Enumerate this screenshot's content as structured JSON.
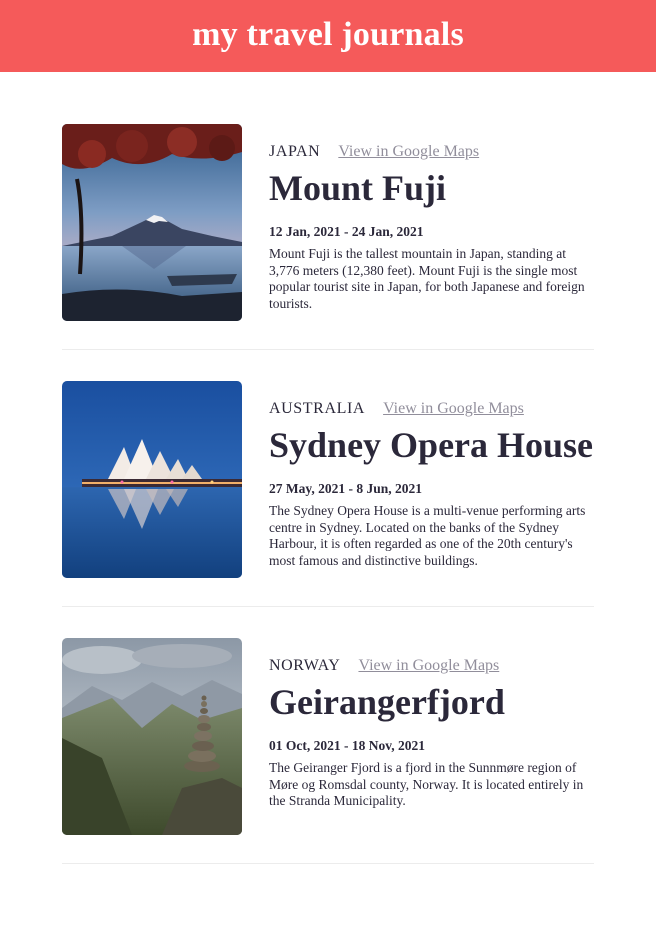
{
  "header": {
    "title": "my travel journals"
  },
  "entries": [
    {
      "country": "JAPAN",
      "map_link": "View in Google Maps",
      "title": "Mount Fuji",
      "dates": "12 Jan, 2021 - 24 Jan, 2021",
      "description": "Mount Fuji is the tallest mountain in Japan, standing at 3,776 meters (12,380 feet). Mount Fuji is the single most popular tourist site in Japan, for both Japanese and foreign tourists."
    },
    {
      "country": "AUSTRALIA",
      "map_link": "View in Google Maps",
      "title": "Sydney Opera House",
      "dates": "27 May, 2021 - 8 Jun, 2021",
      "description": "The Sydney Opera House is a multi-venue performing arts centre in Sydney. Located on the banks of the Sydney Harbour, it is often regarded as one of the 20th century's most famous and distinctive buildings."
    },
    {
      "country": "NORWAY",
      "map_link": "View in Google Maps",
      "title": "Geirangerfjord",
      "dates": "01 Oct, 2021 - 18 Nov, 2021",
      "description": "The Geiranger Fjord is a fjord in the Sunnmøre region of Møre og Romsdal county, Norway. It is located entirely in the Stranda Municipality."
    }
  ],
  "colors": {
    "header_bg": "#f55a5a",
    "text_dark": "#2b283a",
    "link_gray": "#918e9b"
  }
}
